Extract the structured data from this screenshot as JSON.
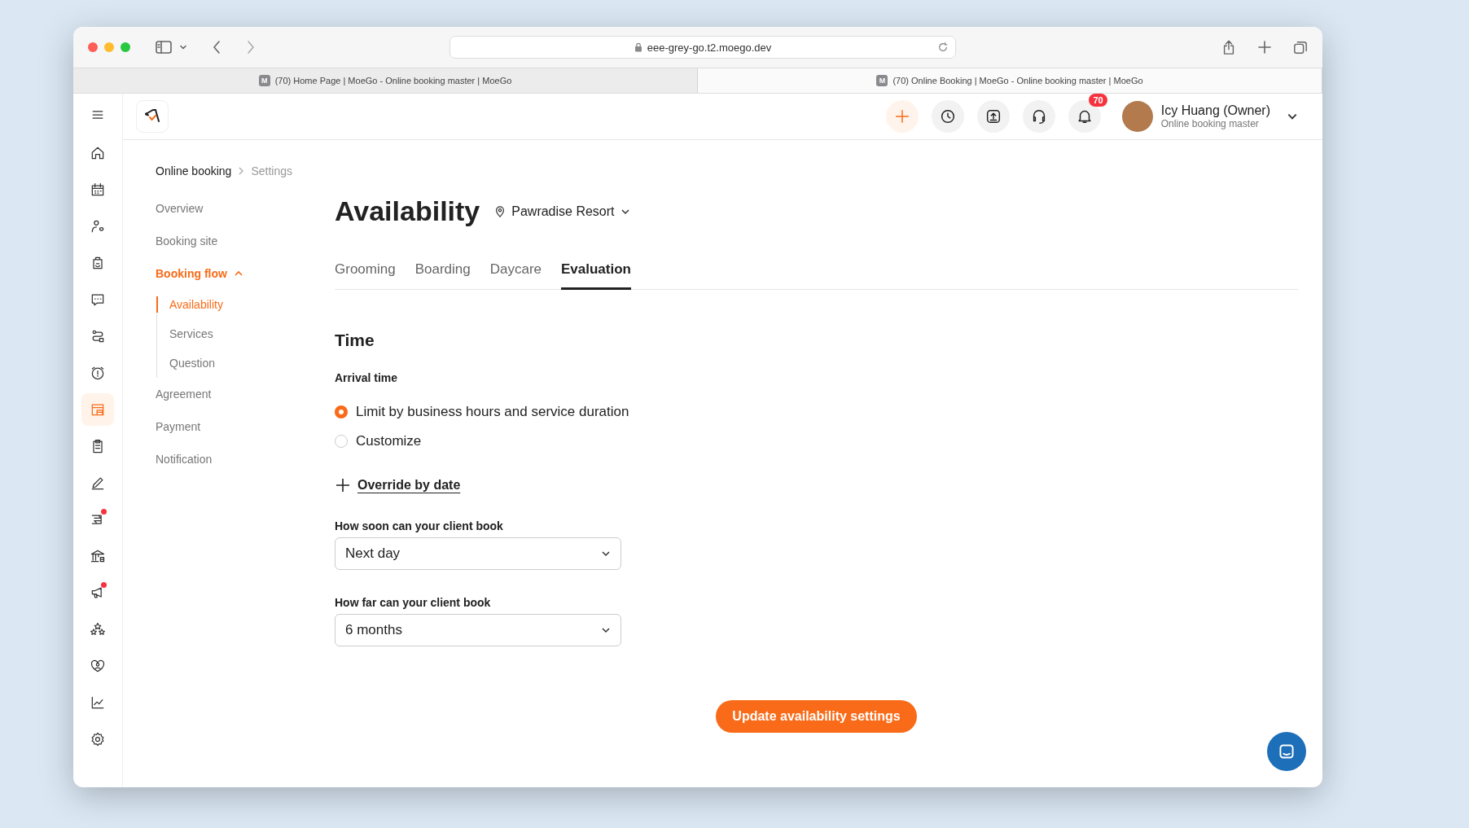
{
  "browser": {
    "url": "eee-grey-go.t2.moego.dev",
    "tabs": [
      {
        "favicon": "M",
        "title": "(70) Home Page | MoeGo - Online booking master | MoeGo",
        "selected": false
      },
      {
        "favicon": "M",
        "title": "(70) Online Booking | MoeGo - Online booking master | MoeGo",
        "selected": true
      }
    ]
  },
  "sidebar": {
    "items": [
      {
        "selected": false,
        "alert": false
      },
      {
        "selected": false,
        "alert": false
      },
      {
        "selected": false,
        "alert": false
      },
      {
        "selected": false,
        "alert": false
      },
      {
        "selected": false,
        "alert": false
      },
      {
        "selected": false,
        "alert": false
      },
      {
        "selected": false,
        "alert": false
      },
      {
        "selected": true,
        "alert": false
      },
      {
        "selected": false,
        "alert": false
      },
      {
        "selected": false,
        "alert": false
      },
      {
        "selected": false,
        "alert": true
      },
      {
        "selected": false,
        "alert": false
      },
      {
        "selected": false,
        "alert": true
      },
      {
        "selected": false,
        "alert": false
      },
      {
        "selected": false,
        "alert": false
      },
      {
        "selected": false,
        "alert": false
      },
      {
        "selected": false,
        "alert": false
      }
    ]
  },
  "header": {
    "notification_count": "70",
    "user": {
      "name": "Icy Huang (Owner)",
      "role": "Online booking master"
    }
  },
  "breadcrumb": [
    "Online booking",
    "Settings"
  ],
  "settings_nav": {
    "items": [
      {
        "label": "Overview",
        "selected": false
      },
      {
        "label": "Booking site",
        "selected": false
      },
      {
        "label": "Booking flow",
        "selected": true,
        "expanded": true,
        "children": [
          {
            "label": "Availability",
            "selected": true
          },
          {
            "label": "Services",
            "selected": false
          },
          {
            "label": "Question",
            "selected": false
          }
        ]
      },
      {
        "label": "Agreement",
        "selected": false
      },
      {
        "label": "Payment",
        "selected": false
      },
      {
        "label": "Notification",
        "selected": false
      }
    ]
  },
  "page": {
    "title": "Availability",
    "location": "Pawradise Resort",
    "tabs": [
      {
        "label": "Grooming",
        "selected": false
      },
      {
        "label": "Boarding",
        "selected": false
      },
      {
        "label": "Daycare",
        "selected": false
      },
      {
        "label": "Evaluation",
        "selected": true
      }
    ],
    "section": "Time",
    "arrival": {
      "label": "Arrival time",
      "options": [
        {
          "label": "Limit by business hours and service duration",
          "selected": true
        },
        {
          "label": "Customize",
          "selected": false
        }
      ]
    },
    "override_link": "Override by date",
    "fields": [
      {
        "label": "How soon can your client book",
        "value": "Next day"
      },
      {
        "label": "How far can your client book",
        "value": "6 months"
      }
    ],
    "submit": "Update availability settings"
  }
}
